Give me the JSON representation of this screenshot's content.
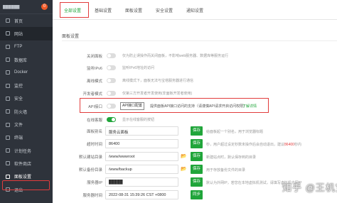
{
  "sidebar": {
    "server_ip": "██████",
    "badge": "0",
    "items": [
      {
        "label": "首页",
        "icon": "home-icon"
      },
      {
        "label": "网站",
        "icon": "globe-icon"
      },
      {
        "label": "FTP",
        "icon": "ftp-icon"
      },
      {
        "label": "数据库",
        "icon": "database-icon"
      },
      {
        "label": "Docker",
        "icon": "docker-icon"
      },
      {
        "label": "监控",
        "icon": "monitor-icon"
      },
      {
        "label": "安全",
        "icon": "shield-icon"
      },
      {
        "label": "防火墙",
        "icon": "firewall-icon"
      },
      {
        "label": "文件",
        "icon": "folder-icon"
      },
      {
        "label": "终端",
        "icon": "terminal-icon"
      },
      {
        "label": "计划任务",
        "icon": "clock-icon"
      },
      {
        "label": "软件商店",
        "icon": "store-icon"
      },
      {
        "label": "面板设置",
        "icon": "gear-icon"
      },
      {
        "label": "退出",
        "icon": "logout-icon"
      }
    ]
  },
  "tabs": [
    "全部设置",
    "基础设置",
    "面板设置",
    "安全设置",
    "通知设置"
  ],
  "panel_title": "面板设置",
  "settings": {
    "close_panel": {
      "label": "关闭面板",
      "hint": "仅为防止误操作而关闭面板，不影响web服务器、数据库等服务运行"
    },
    "listen_ipv6": {
      "label": "监听IPv6",
      "hint": "监听IPv6地址的访问"
    },
    "offline_mode": {
      "label": "离线模式",
      "hint": "离线模式下，面板无法与宝塔服务器进行通信"
    },
    "dev_mode": {
      "label": "开发者模式",
      "hint": "仅第三方开发者开发使用(非面板开发者使用)"
    },
    "api": {
      "label": "API接口",
      "config_btn": "API接口配置",
      "hint": "提供面板API接口访问的支持（请谨慎API请求开启访问权限）",
      "link": "了解详情"
    },
    "online_service": {
      "label": "在线客服",
      "hint": "显示在线客服的按钮"
    },
    "panel_alias": {
      "label": "面板别名",
      "value": "服务云面板",
      "save": "保存",
      "hint": "给面板起一个别名，用于浏览器标题"
    },
    "timeout": {
      "label": "超时时间",
      "value": "86400",
      "save": "保存",
      "hint_pre": "秒，用户超过设定秒数未操作后会自动退出，建议",
      "hint_red": "86400",
      "hint_post": "秒内"
    },
    "default_site_dir": {
      "label": "默认建站目录",
      "value": "/www/wwwroot",
      "save": "保存",
      "hint": "新建站点时，默认保存到的目录"
    },
    "default_backup_dir": {
      "label": "默认备份目录",
      "value": "/www/backup",
      "save": "保存",
      "hint": "用于存放备份文件的目录"
    },
    "server_ip": {
      "label": "服务器IP",
      "value": "█████",
      "save": "保存",
      "hint": "默认为外网IP，若您在本地虚拟机测试，请填写虚拟机内网IP"
    },
    "server_time": {
      "label": "服务器时间",
      "value": "2022-08-31 15:39:26 CST +0800",
      "sync": "同步"
    }
  },
  "watermark": "知乎 @王机宝贝"
}
